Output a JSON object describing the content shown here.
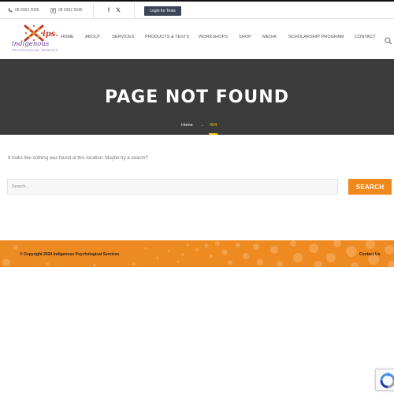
{
  "topbar": {
    "phone1": "08 9362 2006",
    "phone2": "08 9362 5546",
    "social": {
      "facebook_glyph": "f",
      "x_glyph": "𝕏"
    },
    "login_label": "Login for Tests"
  },
  "nav": {
    "items": [
      {
        "label": "HOME"
      },
      {
        "label": "ABOUT"
      },
      {
        "label": "SERVICES"
      },
      {
        "label": "PRODUCTS & TESTS"
      },
      {
        "label": "WORKSHOPS"
      },
      {
        "label": "SHOP"
      },
      {
        "label": "MEDIA"
      },
      {
        "label": "SCHOLARSHIP PROGRAM"
      },
      {
        "label": "CONTACT"
      }
    ]
  },
  "logo": {
    "mark": "ips.",
    "name": "indigenous",
    "tagline": "PSYCHOLOGICAL SERVICES"
  },
  "hero": {
    "title": "PAGE NOT FOUND",
    "breadcrumb": {
      "home": "Home",
      "arrow": "→",
      "current": "404"
    }
  },
  "content": {
    "message": "It looks like nothing was found at this location. Maybe try a search?",
    "search_placeholder": "Search...",
    "search_button": "SEARCH"
  },
  "footer": {
    "copyright": "© Copyright 2024 Indigenous Psychological Services",
    "contact": "Contact Us"
  },
  "colors": {
    "accent": "#f0891c",
    "hero_bg": "#3b3b3b",
    "breadcrumb_active": "#f5c400",
    "login_bg": "#3a4557"
  },
  "icons": [
    "phone-icon",
    "fax-icon",
    "facebook-icon",
    "x-icon",
    "search-icon",
    "recaptcha-icon"
  ]
}
